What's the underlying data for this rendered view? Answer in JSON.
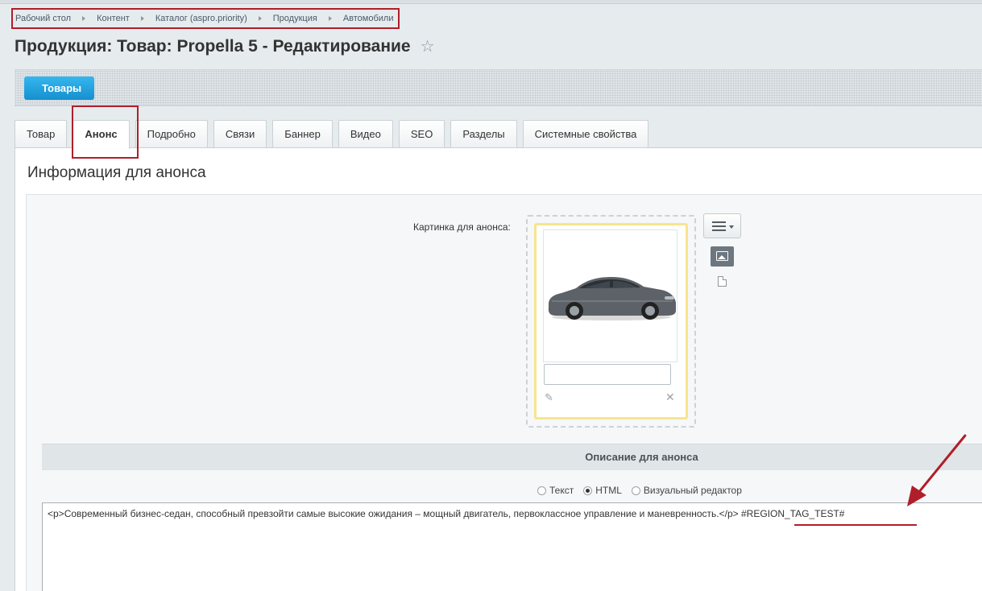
{
  "breadcrumb": [
    "Рабочий стол",
    "Контент",
    "Каталог (aspro.priority)",
    "Продукция",
    "Автомобили"
  ],
  "page": {
    "title": "Продукция: Товар: Propella 5 - Редактирование",
    "favorite_icon": "star-icon"
  },
  "toolbar": {
    "back_label": "Товары"
  },
  "tabs": [
    {
      "label": "Товар"
    },
    {
      "label": "Анонс",
      "active": true
    },
    {
      "label": "Подробно"
    },
    {
      "label": "Связи"
    },
    {
      "label": "Баннер"
    },
    {
      "label": "Видео"
    },
    {
      "label": "SEO"
    },
    {
      "label": "Разделы"
    },
    {
      "label": "Системные свойства"
    }
  ],
  "section": {
    "heading": "Информация для анонса",
    "picture_label": "Картинка для анонса:",
    "picture_caption": "",
    "description_heading": "Описание для анонса",
    "modes": [
      {
        "label": "Текст",
        "checked": false
      },
      {
        "label": "HTML",
        "checked": true
      },
      {
        "label": "Визуальный редактор",
        "checked": false
      }
    ],
    "description_text": "<p>Современный бизнес-седан, способный превзойти самые высокие ожидания – мощный двигатель, первоклассное управление и маневренность.</p> #REGION_TAG_TEST#"
  },
  "colors": {
    "accent": "#1e9bd9",
    "annotation": "#b01e2a",
    "image_frame": "#f7e58c"
  }
}
